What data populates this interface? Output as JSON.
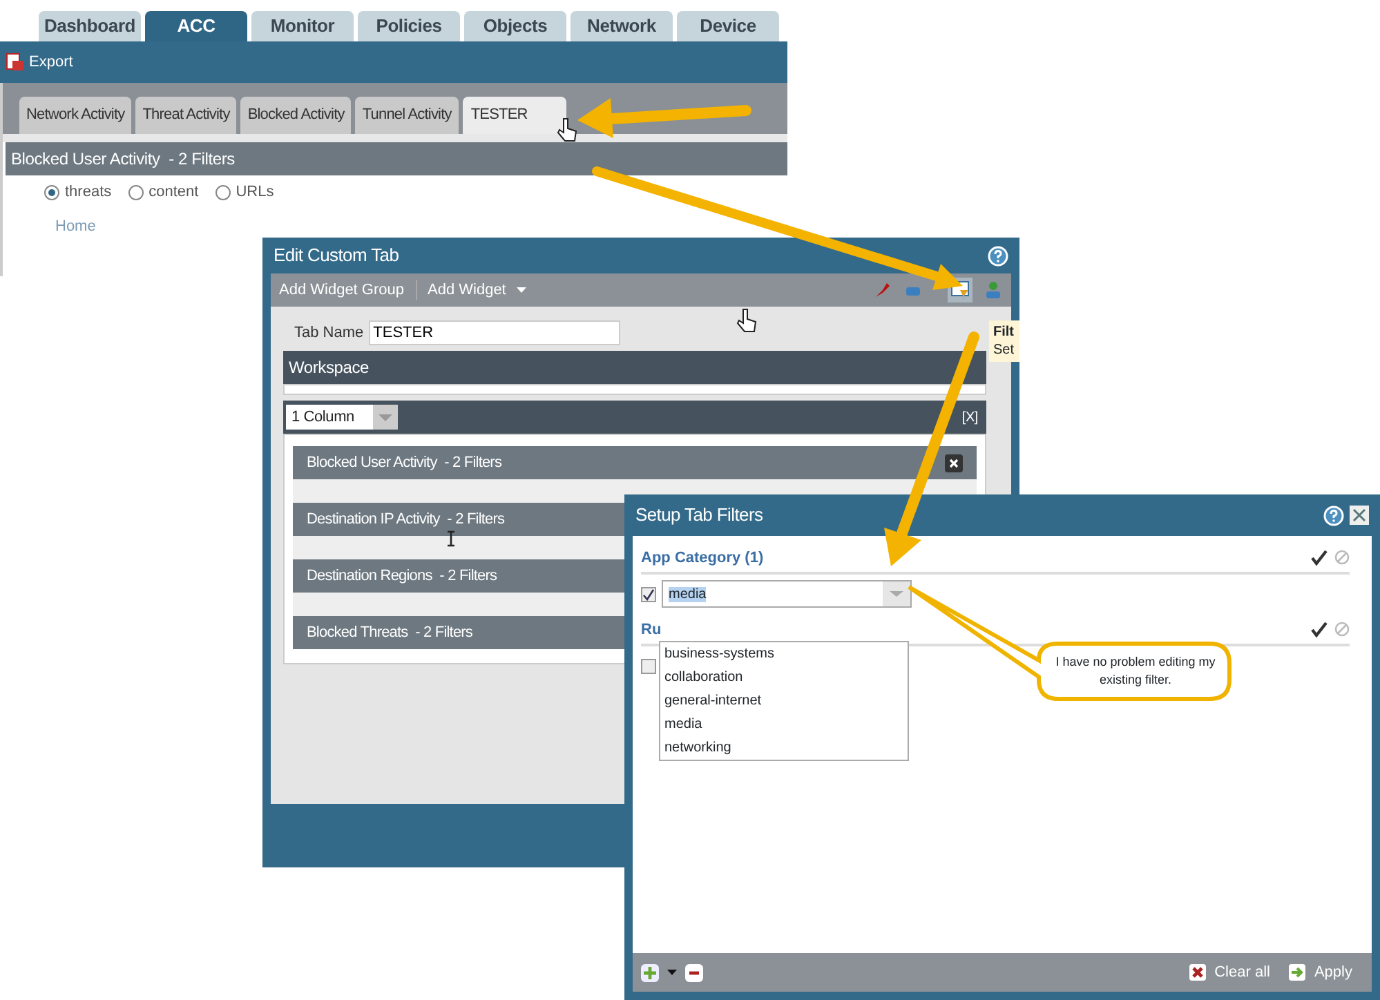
{
  "main_tabs": [
    {
      "label": "Dashboard",
      "selected": false
    },
    {
      "label": "ACC",
      "selected": true
    },
    {
      "label": "Monitor",
      "selected": false
    },
    {
      "label": "Policies",
      "selected": false
    },
    {
      "label": "Objects",
      "selected": false
    },
    {
      "label": "Network",
      "selected": false
    },
    {
      "label": "Device",
      "selected": false
    }
  ],
  "toolbar": {
    "export_label": "Export"
  },
  "acc_tabs": [
    {
      "label": "Network Activity",
      "selected": false
    },
    {
      "label": "Threat Activity",
      "selected": false
    },
    {
      "label": "Blocked Activity",
      "selected": false
    },
    {
      "label": "Tunnel Activity",
      "selected": false
    },
    {
      "label": "TESTER",
      "selected": true
    }
  ],
  "widget": {
    "title": "Blocked User Activity  - 2 Filters",
    "radios": [
      {
        "label": "threats",
        "selected": true
      },
      {
        "label": "content",
        "selected": false
      },
      {
        "label": "URLs",
        "selected": false
      }
    ],
    "link": "Home"
  },
  "edit_dialog": {
    "title": "Edit Custom Tab",
    "toolbar": [
      "Add Widget Group",
      "Add Widget"
    ],
    "tab_name_label": "Tab Name",
    "tab_name_value": "TESTER",
    "workspace_title": "Workspace",
    "layout_select": "1 Column",
    "remove_label": "[X]",
    "widgets": [
      {
        "title": "Blocked User Activity  - 2 Filters",
        "closable": true
      },
      {
        "title": "Destination IP Activity  - 2 Filters"
      },
      {
        "title": "Destination Regions  - 2 Filters"
      },
      {
        "title": "Blocked Threats  - 2 Filters"
      }
    ]
  },
  "tooltip": {
    "title": "Filt",
    "text": "Set"
  },
  "filter_dialog": {
    "title": "Setup Tab Filters",
    "sections": [
      {
        "title": "App Category (1)",
        "checked": true,
        "value": "media"
      },
      {
        "title": "Ru",
        "checked": false
      }
    ],
    "dropdown_options": [
      "business-systems",
      "collaboration",
      "general-internet",
      "media",
      "networking"
    ],
    "footer": {
      "clear": "Clear all",
      "apply": "Apply"
    }
  },
  "callout": "I have no problem editing my existing filter."
}
